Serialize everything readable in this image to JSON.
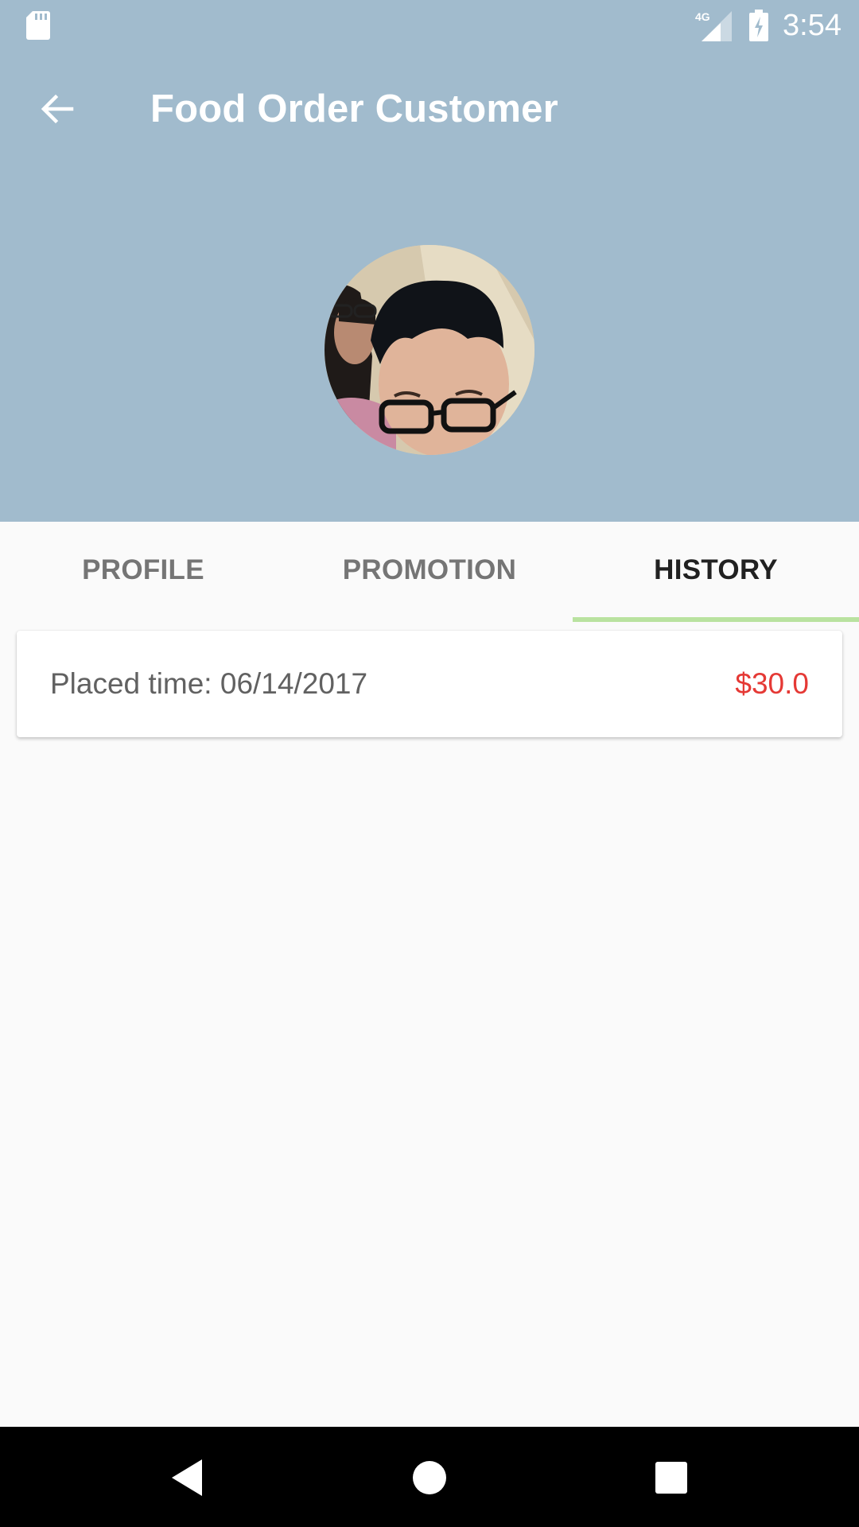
{
  "status_bar": {
    "time": "3:54",
    "network": "4G",
    "icons": [
      "sd-card-icon",
      "cell-signal-icon",
      "battery-charging-icon"
    ]
  },
  "toolbar": {
    "title": "Food Order Customer",
    "back_icon": "arrow-back-icon"
  },
  "profile": {
    "avatar": "profile-photo"
  },
  "tabs": [
    {
      "label": "PROFILE",
      "active": false
    },
    {
      "label": "PROMOTION",
      "active": false
    },
    {
      "label": "HISTORY",
      "active": true
    }
  ],
  "history": {
    "orders": [
      {
        "placed_time": "Placed time: 06/14/2017",
        "amount": "$30.0"
      }
    ]
  },
  "nav_bar": {
    "buttons": [
      "back-triangle-icon",
      "home-circle-icon",
      "recents-square-icon"
    ]
  },
  "colors": {
    "header_bg": "#a1bbcd",
    "tab_indicator": "#b9e2a0",
    "amount": "#e53935",
    "background": "#fafafa"
  }
}
